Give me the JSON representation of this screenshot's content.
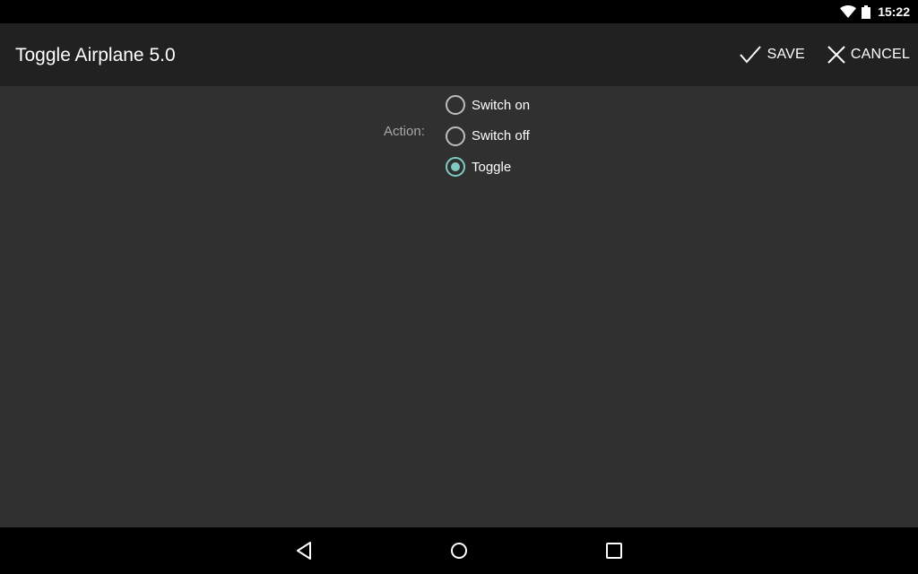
{
  "status_bar": {
    "time": "15:22",
    "icons": [
      "wifi-icon",
      "battery-icon"
    ]
  },
  "app_bar": {
    "title": "Toggle Airplane 5.0",
    "save_label": "SAVE",
    "cancel_label": "CANCEL",
    "save_icon": "check-icon",
    "cancel_icon": "close-icon"
  },
  "form": {
    "action_label": "Action:",
    "options": [
      {
        "label": "Switch on",
        "checked": false
      },
      {
        "label": "Switch off",
        "checked": false
      },
      {
        "label": "Toggle",
        "checked": true
      }
    ],
    "accent_color": "#80cbc4"
  },
  "nav_bar": {
    "icons": [
      "back-icon",
      "home-icon",
      "recents-icon"
    ]
  }
}
